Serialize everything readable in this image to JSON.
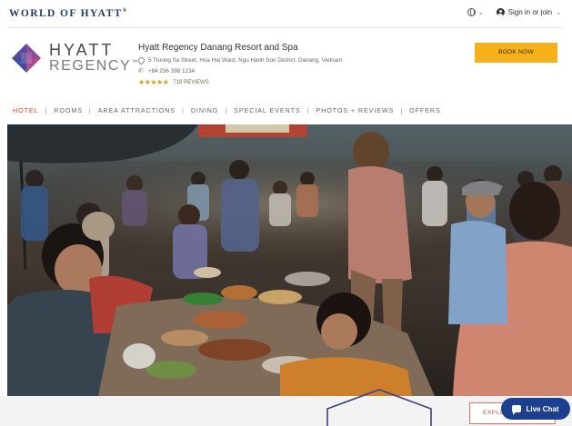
{
  "brand": {
    "world_of_hyatt": "WORLD OF HYATT",
    "reg_mark": "®"
  },
  "top_nav": {
    "language_icon": "globe-icon",
    "sign_in_label": "Sign in or join"
  },
  "logo": {
    "line1": "HYATT",
    "line2": "REGENCY",
    "tm": "™",
    "colors": [
      "#6a4c93",
      "#3f4fa0",
      "#9b3a8c",
      "#c0508e"
    ]
  },
  "hotel": {
    "name": "Hyatt Regency Danang Resort and Spa",
    "address": "5 Truong Sa Street, Hoa Hai Ward, Ngu Hanh Son District, Danang, Vietnam",
    "phone": "+84 236 398 1234",
    "stars": "★★★★★",
    "rating": 4.5,
    "reviews": "718 REVIEWS"
  },
  "book_now_label": "BOOK NOW",
  "nav": {
    "items": [
      {
        "label": "HOTEL",
        "active": true
      },
      {
        "label": "ROOMS",
        "active": false
      },
      {
        "label": "AREA ATTRACTIONS",
        "active": false
      },
      {
        "label": "DINING",
        "active": false
      },
      {
        "label": "SPECIAL EVENTS",
        "active": false
      },
      {
        "label": "PHOTOS + REVIEWS",
        "active": false
      },
      {
        "label": "OFFERS",
        "active": false
      }
    ],
    "separator": "|"
  },
  "hero": {
    "description": "Street food market photo"
  },
  "explore_label": "EXPLO",
  "live_chat_label": "Live Chat",
  "colors": {
    "accent_orange": "#d5451b",
    "book_yellow": "#f5b01a",
    "chat_blue": "#1c3f8f"
  }
}
